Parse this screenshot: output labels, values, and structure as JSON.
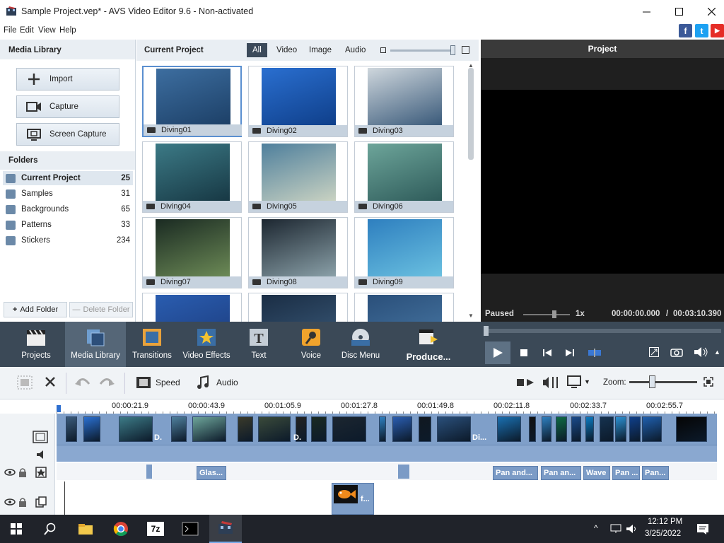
{
  "window": {
    "title": "Sample Project.vep* - AVS Video Editor 9.6 - Non-activated",
    "minimize_icon": "minimize-icon",
    "maximize_icon": "maximize-icon",
    "close_icon": "close-icon"
  },
  "menu": [
    "File",
    "Edit",
    "View",
    "Help"
  ],
  "social": {
    "facebook": "f",
    "twitter": "t",
    "youtube": "▶"
  },
  "media_library": {
    "header": "Media Library",
    "buttons": [
      "Import",
      "Capture",
      "Screen Capture"
    ],
    "folders_header": "Folders",
    "folders": [
      {
        "name": "Current Project",
        "count": "25"
      },
      {
        "name": "Samples",
        "count": "31"
      },
      {
        "name": "Backgrounds",
        "count": "65"
      },
      {
        "name": "Patterns",
        "count": "33"
      },
      {
        "name": "Stickers",
        "count": "234"
      }
    ],
    "add_folder": "Add Folder",
    "delete_folder": "Delete Folder"
  },
  "current_project": {
    "header": "Current Project",
    "filters": [
      "All",
      "Video",
      "Image",
      "Audio"
    ],
    "clips": [
      "Diving01",
      "Diving02",
      "Diving03",
      "Diving04",
      "Diving05",
      "Diving06",
      "Diving07",
      "Diving08",
      "Diving09",
      "",
      "",
      ""
    ]
  },
  "preview": {
    "header": "Project",
    "status": "Paused",
    "speed": "1x",
    "time": "00:00:00.000",
    "separator": "/",
    "duration": "00:03:10.390"
  },
  "toolbar": [
    "Projects",
    "Media Library",
    "Transitions",
    "Video Effects",
    "Text",
    "Voice",
    "Disc Menu",
    "Produce..."
  ],
  "timeline": {
    "speed": "Speed",
    "audio": "Audio",
    "zoom": "Zoom:",
    "ticks": [
      "00:00:21.9",
      "00:00:43.9",
      "00:01:05.9",
      "00:01:27.8",
      "00:01:49.8",
      "00:02:11.8",
      "00:02:33.7",
      "00:02:55.7"
    ],
    "video_clip_labels": [
      "D.",
      "D.",
      "Di..."
    ],
    "effects": [
      "Glas...",
      "Pan and...",
      "Pan an...",
      "Wave",
      "Pan ...",
      "Pan..."
    ],
    "overlay_label": "f..."
  },
  "taskbar": {
    "time": "12:12 PM",
    "date": "3/25/2022",
    "zip_label": "7z"
  }
}
